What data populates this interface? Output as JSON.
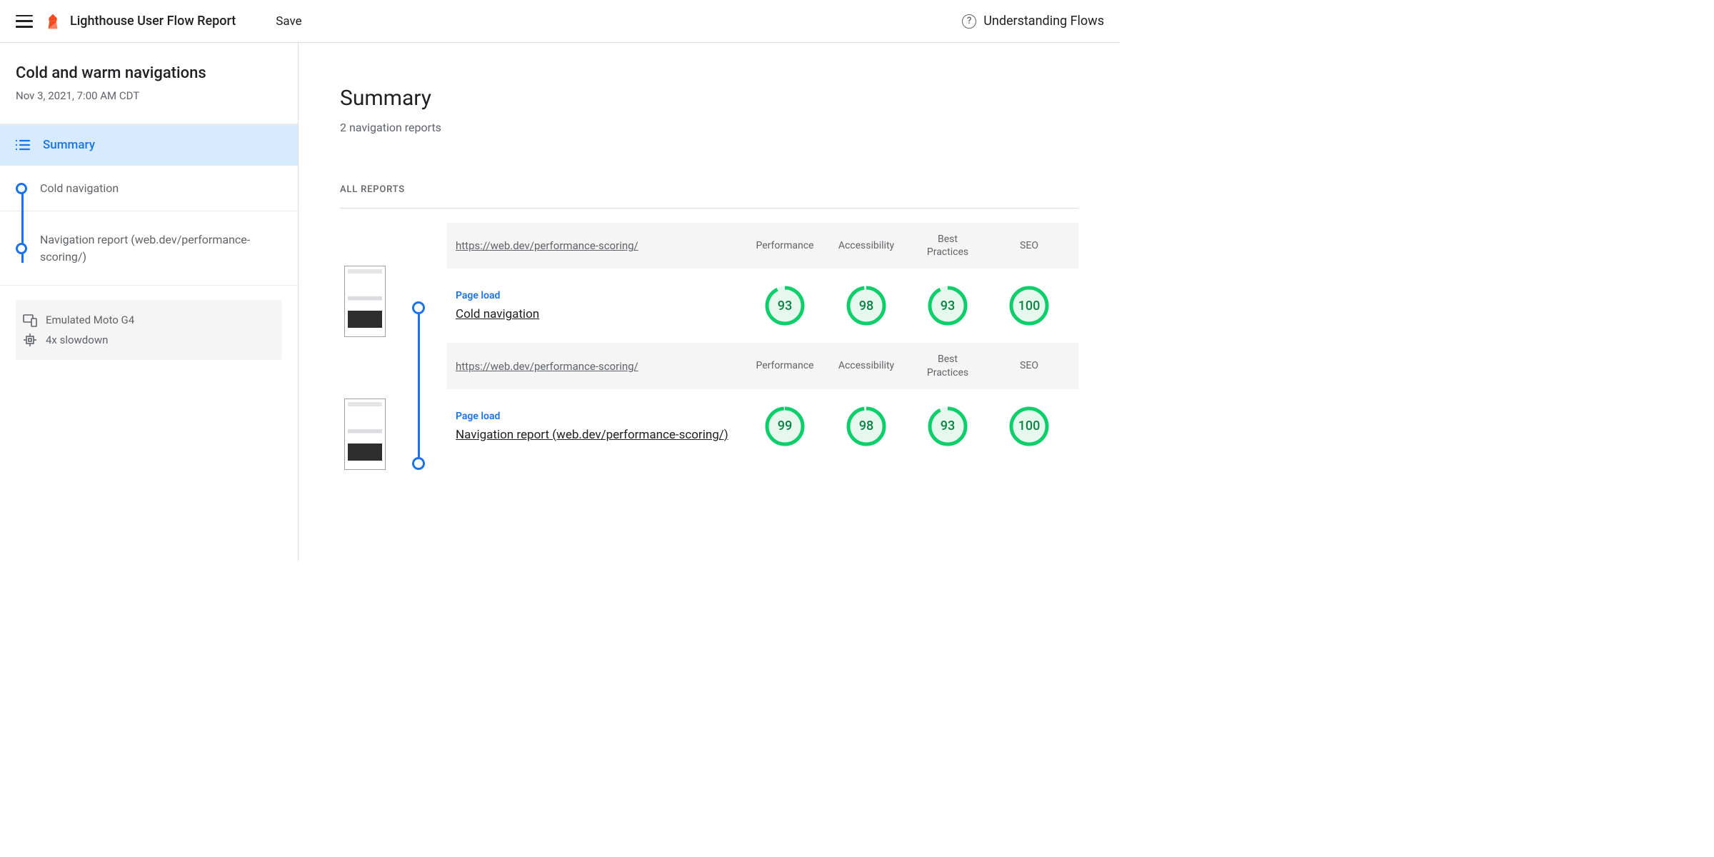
{
  "topbar": {
    "title": "Lighthouse User Flow Report",
    "save": "Save",
    "help": "Understanding Flows"
  },
  "sidebar": {
    "flow_title": "Cold and warm navigations",
    "flow_date": "Nov 3, 2021, 7:00 AM CDT",
    "summary_label": "Summary",
    "steps": [
      {
        "label": "Cold navigation"
      },
      {
        "label": "Navigation report (web.dev/performance-scoring/)"
      }
    ],
    "env": {
      "device": "Emulated Moto G4",
      "throttle": "4x slowdown"
    }
  },
  "content": {
    "title": "Summary",
    "subtitle": "2 navigation reports",
    "all_reports": "ALL REPORTS",
    "metric_heads": [
      "Performance",
      "Accessibility",
      "Best Practices",
      "SEO"
    ],
    "page_load": "Page load",
    "reports": [
      {
        "url": "https://web.dev/performance-scoring/",
        "name": "Cold navigation",
        "scores": [
          93,
          98,
          93,
          100
        ]
      },
      {
        "url": "https://web.dev/performance-scoring/",
        "name": "Navigation report (web.dev/performance-scoring/)",
        "scores": [
          99,
          98,
          93,
          100
        ]
      }
    ]
  },
  "colors": {
    "accent": "#1a73e8",
    "pass": "#0cce6b"
  }
}
